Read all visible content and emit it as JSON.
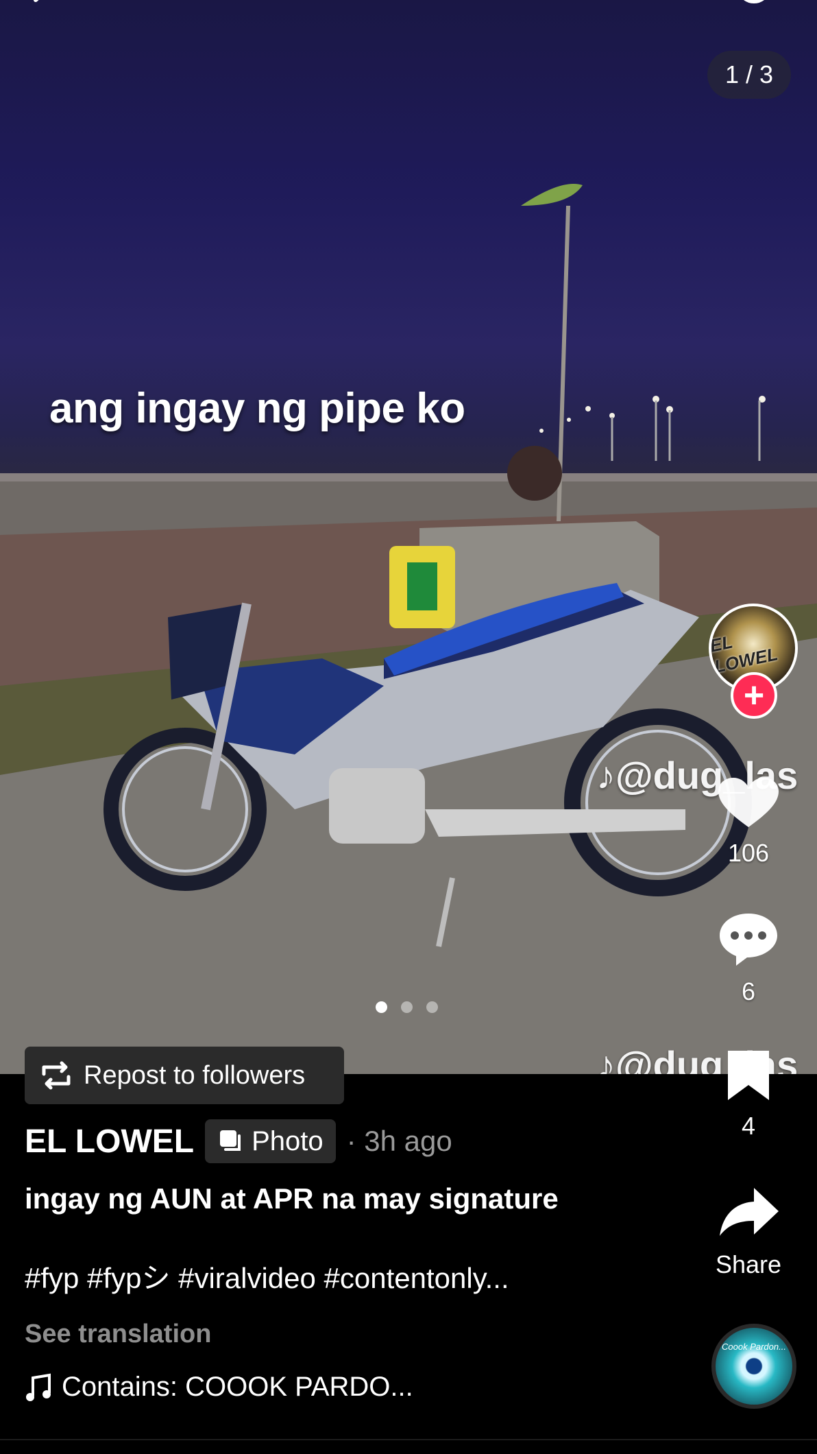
{
  "photo": {
    "overlay_caption": "ang ingay ng pipe ko",
    "page_counter": "1 / 3",
    "watermark_handle": "@dug_las",
    "carousel": {
      "total": 3,
      "active": 1
    }
  },
  "repost": {
    "label": "Repost to followers"
  },
  "side_actions": {
    "avatar_text": "EL LOWEL",
    "follow_symbol": "+",
    "likes": "106",
    "comments": "6",
    "favorites": "4",
    "share_label": "Share"
  },
  "post": {
    "author": "EL LOWEL",
    "type_badge": "Photo",
    "time": "· 3h ago",
    "caption": "ingay ng AUN at APR na may signature",
    "hashtags": "#fyp #fypシ #viralvideo #contentonly...",
    "see_translation": "See translation",
    "music": "Contains: COOOK PARDO...",
    "music_disc_text": "Coook Pardon..."
  },
  "colors": {
    "follow": "#fe2c55",
    "muted": "#9a9a9a",
    "badge_bg": "#2b2b2b"
  }
}
